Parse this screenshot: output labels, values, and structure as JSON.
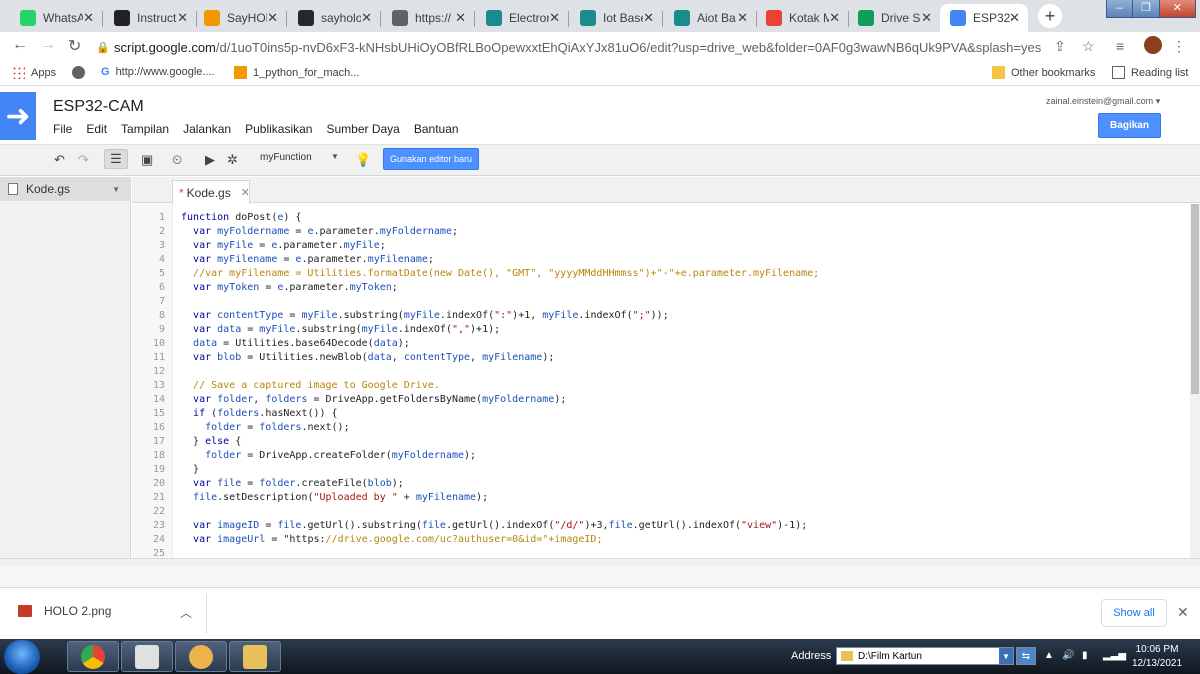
{
  "browser": {
    "tabs": [
      {
        "label": "WhatsA",
        "icon": "whatsapp-icon",
        "color": "#25d366"
      },
      {
        "label": "Instructi",
        "icon": "instructables-icon",
        "color": "#222222"
      },
      {
        "label": "SayHOL",
        "icon": "sayholo-icon",
        "color": "#f29900"
      },
      {
        "label": "sayholo",
        "icon": "github-icon",
        "color": "#24292e"
      },
      {
        "label": "https://",
        "icon": "globe-icon",
        "color": "#5f6368"
      },
      {
        "label": "Electron",
        "icon": "ew-icon",
        "color": "#1a8c8c"
      },
      {
        "label": "Iot Base",
        "icon": "ew-icon",
        "color": "#1a8c8c"
      },
      {
        "label": "Aiot Ba",
        "icon": "ew-icon",
        "color": "#1a8c8c"
      },
      {
        "label": "Kotak M",
        "icon": "gmail-icon",
        "color": "#ea4335"
      },
      {
        "label": "Drive Se",
        "icon": "drive-icon",
        "color": "#0f9d58"
      },
      {
        "label": "ESP32-C",
        "icon": "apps-script-icon",
        "color": "#4285f4",
        "active": true
      }
    ],
    "tab_close": "✕",
    "new_tab": "+",
    "url_host": "script.google.com",
    "url_rest": "/d/1uoT0ins5p-nvD6xF3-kNHsbUHiOyOBfRLBoOpewxxtEhQiAxYJx81uO6/edit?usp=drive_web&folder=0AF0g3wawNB6qUk9PVA&splash=yes",
    "bookmarks": {
      "apps": "Apps",
      "google": "http://www.google....",
      "python": "1_python_for_mach...",
      "other": "Other bookmarks",
      "reading": "Reading list"
    }
  },
  "apps_script": {
    "project_title": "ESP32-CAM",
    "menu": [
      "File",
      "Edit",
      "Tampilan",
      "Jalankan",
      "Publikasikan",
      "Sumber Daya",
      "Bantuan"
    ],
    "account_email": "zainal.einstein@gmail.com",
    "account_arrow": "▾",
    "share_label": "Bagikan",
    "function_select": "myFunction",
    "new_editor_label": "Gunakan editor baru",
    "sidebar_file": "Kode.gs",
    "editor_tab": "Kode.gs",
    "editor_tab_marker": "*",
    "code_lines": [
      "function doPost(e) {",
      "  var myFoldername = e.parameter.myFoldername;",
      "  var myFile = e.parameter.myFile;",
      "  var myFilename = e.parameter.myFilename;",
      "  //var myFilename = Utilities.formatDate(new Date(), \"GMT\", \"yyyyMMddHHmmss\")+\"-\"+e.parameter.myFilename;",
      "  var myToken = e.parameter.myToken;",
      "",
      "  var contentType = myFile.substring(myFile.indexOf(\":\")+1, myFile.indexOf(\";\"));",
      "  var data = myFile.substring(myFile.indexOf(\",\")+1);",
      "  data = Utilities.base64Decode(data);",
      "  var blob = Utilities.newBlob(data, contentType, myFilename);",
      "",
      "  // Save a captured image to Google Drive.",
      "  var folder, folders = DriveApp.getFoldersByName(myFoldername);",
      "  if (folders.hasNext()) {",
      "    folder = folders.next();",
      "  } else {",
      "    folder = DriveApp.createFolder(myFoldername);",
      "  }",
      "  var file = folder.createFile(blob);",
      "  file.setDescription(\"Uploaded by \" + myFilename);",
      "",
      "  var imageID = file.getUrl().substring(file.getUrl().indexOf(\"/d/\")+3,file.getUrl().indexOf(\"view\")-1);",
      "  var imageUrl = \"https://drive.google.com/uc?authuser=0&id=\"+imageID;",
      ""
    ]
  },
  "downloads": {
    "file": "HOLO 2.png",
    "show_all": "Show all"
  },
  "taskbar": {
    "address_label": "Address",
    "address_value": "D:\\Film Kartun",
    "time": "10:06 PM",
    "date": "12/13/2021"
  }
}
